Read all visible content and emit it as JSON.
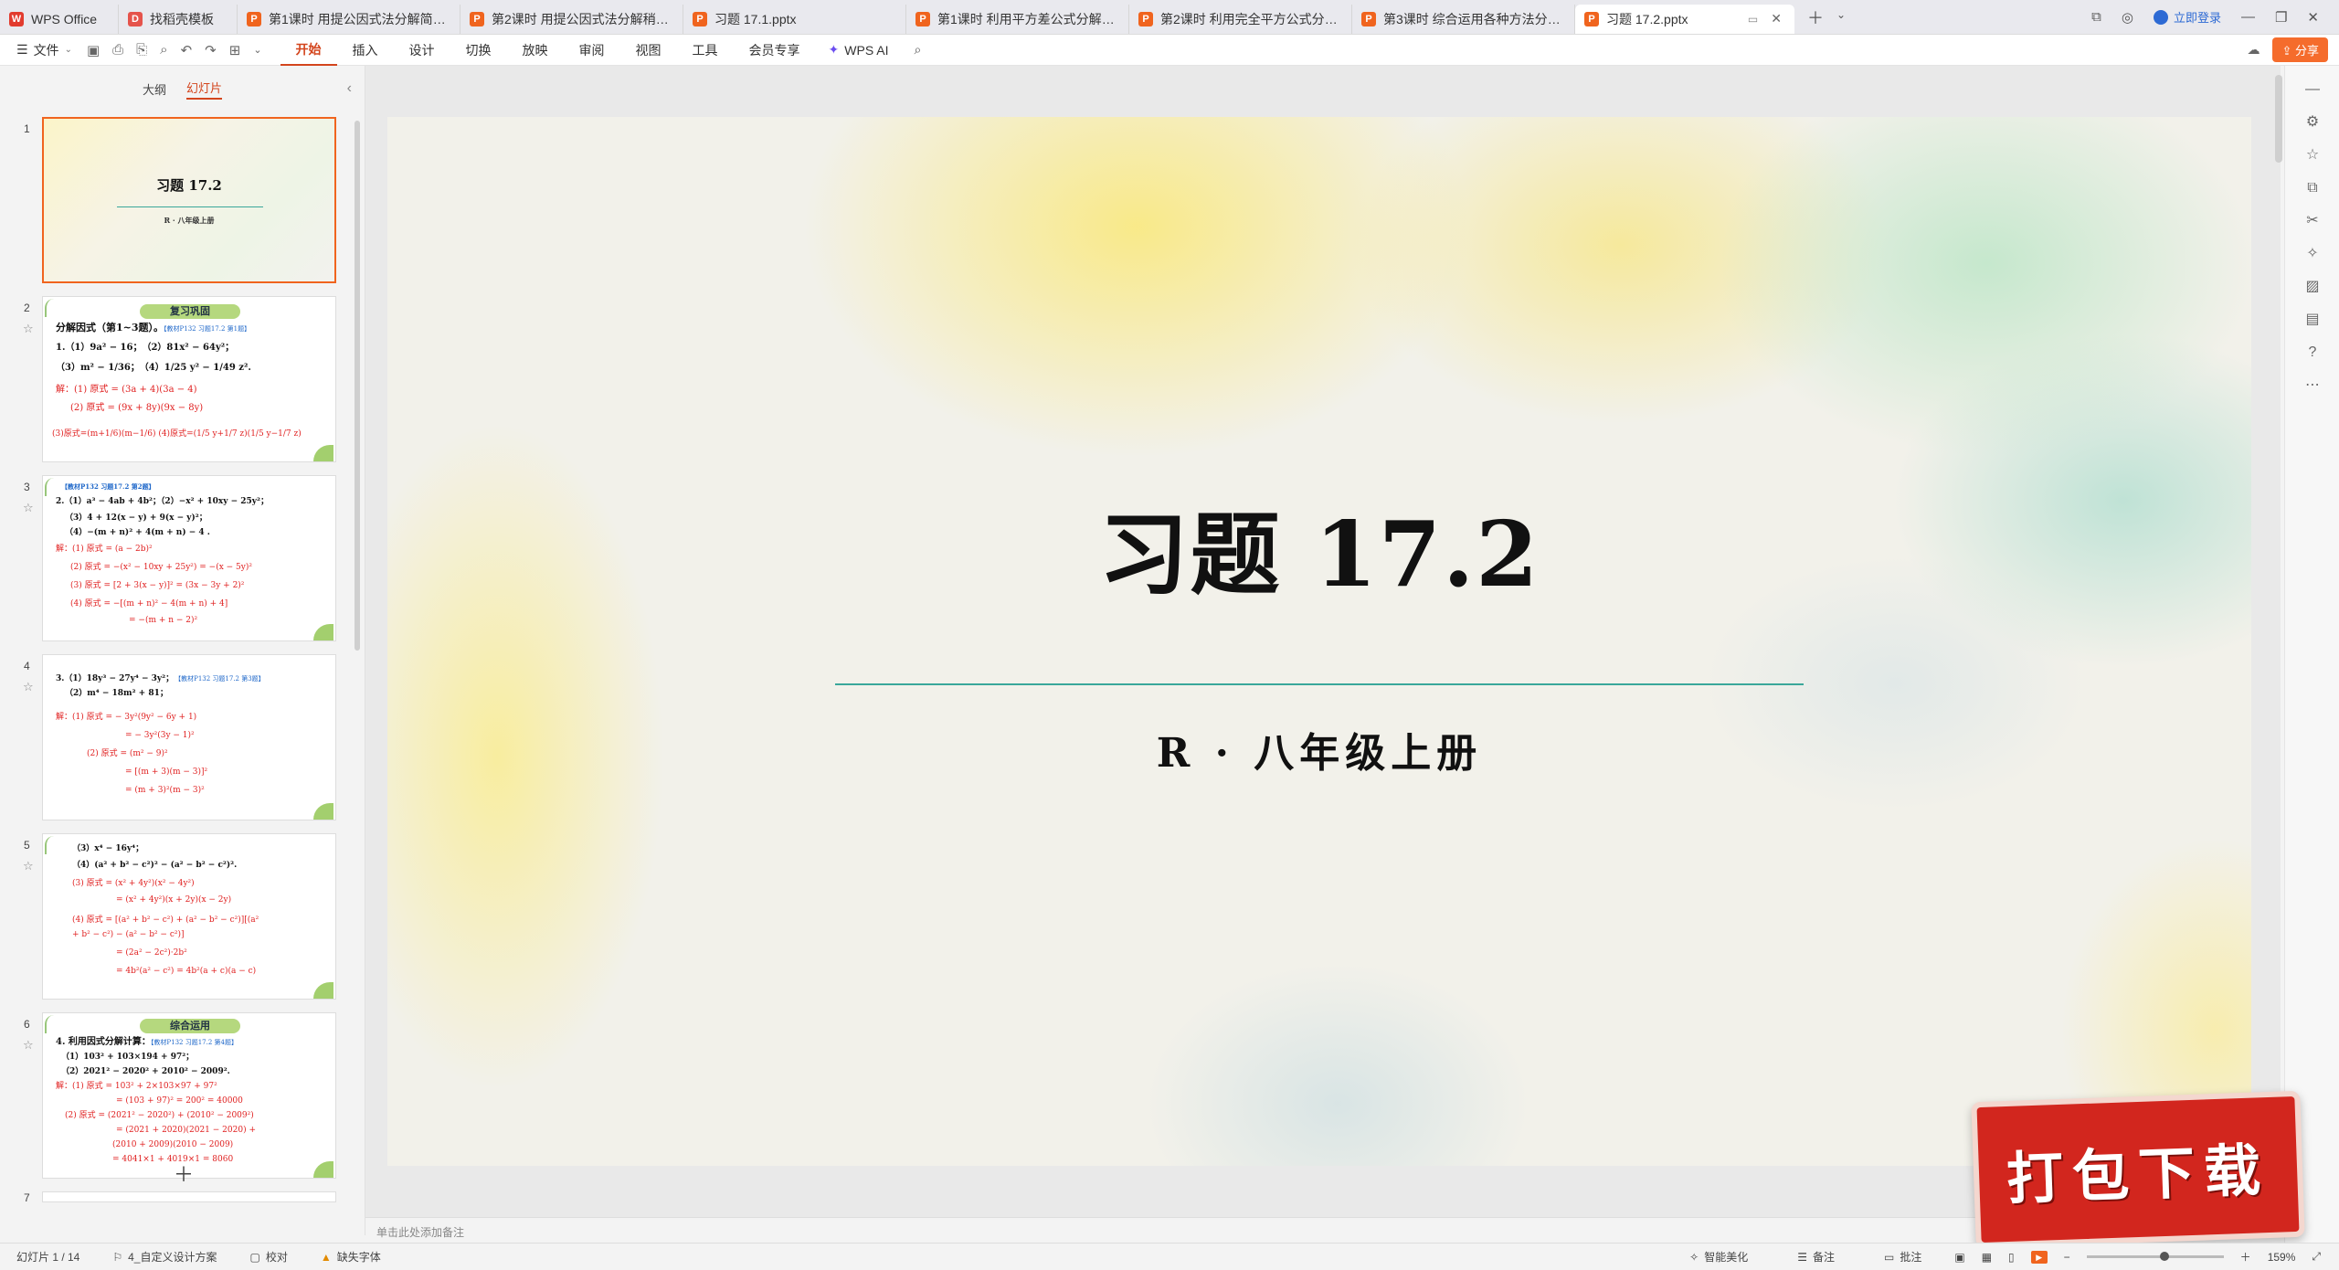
{
  "tabs": [
    {
      "label": "WPS Office",
      "icon": "wps"
    },
    {
      "label": "找稻壳模板",
      "icon": "doc"
    },
    {
      "label": "第1课时 用提公因式法分解简单的因式",
      "icon": "p"
    },
    {
      "label": "第2课时 用提公因式法分解稍复杂的因",
      "icon": "p"
    },
    {
      "label": "习题 17.1.pptx",
      "icon": "p"
    },
    {
      "label": "第1课时 利用平方差公式分解因式.pp",
      "icon": "p"
    },
    {
      "label": "第2课时 利用完全平方公式分解因式.p",
      "icon": "p"
    },
    {
      "label": "第3课时 综合运用各种方法分解因式.p",
      "icon": "p"
    },
    {
      "label": "习题 17.2.pptx",
      "icon": "p",
      "active": true
    }
  ],
  "titlebar": {
    "login": "立即登录"
  },
  "ribbon": {
    "file": "文件",
    "tabs": [
      "开始",
      "插入",
      "设计",
      "切换",
      "放映",
      "审阅",
      "视图",
      "工具",
      "会员专享"
    ],
    "active_tab": "开始",
    "ai": "WPS AI",
    "share": "分享"
  },
  "left_panel": {
    "outline": "大纲",
    "slides": "幻灯片"
  },
  "thumbnails": {
    "t1": {
      "num": "1",
      "title": "习题 17.2",
      "sub": "R · 八年级上册"
    },
    "t2": {
      "num": "2",
      "banner": "复习巩固",
      "l1": "分解因式（第1~3题）。",
      "l1b": "【教材P132 习题17.2 第1题】",
      "l2": "1.（1）9a² − 16；　（2）81x² − 64y²；",
      "l3": "（3）m² − 1/36；　（4）1/25 y² − 1/49 z².",
      "l4": "解：(1) 原式 = (3a + 4)(3a − 4)",
      "l5": "(2) 原式 = (9x + 8y)(9x − 8y)",
      "l6": "(3)原式=(m+1/6)(m−1/6)  (4)原式=(1/5 y+1/7 z)(1/5 y−1/7 z)"
    },
    "t3": {
      "num": "3",
      "l0": "【教材P132 习题17.2 第2题】",
      "l1": "2.（1）a³ − 4ab + 4b²；（2）−x² + 10xy − 25y²；",
      "l2": "（3）4 + 12(x − y) + 9(x − y)²；",
      "l3": "（4）−(m + n)² + 4(m + n) − 4 .",
      "l4": "解：(1) 原式 = (a − 2b)²",
      "l5": "(2) 原式 = −(x² − 10xy + 25y²) = −(x − 5y)²",
      "l6": "(3) 原式 = [2 + 3(x − y)]² = (3x − 3y + 2)²",
      "l7": "(4) 原式 = −[(m + n)² − 4(m + n) + 4]",
      "l8": "= −(m + n − 2)²"
    },
    "t4": {
      "num": "4",
      "l1": "3.（1）18y³ − 27y⁴ − 3y²；",
      "l1b": "【教材P132 习题17.2 第3题】",
      "l2": "（2）m⁴ − 18m² + 81；",
      "l3": "解：(1) 原式 = − 3y²(9y² − 6y + 1)",
      "l4": "= − 3y²(3y − 1)²",
      "l5": "(2) 原式 = (m² − 9)²",
      "l6": "= [(m + 3)(m − 3)]²",
      "l7": "= (m + 3)²(m − 3)²"
    },
    "t5": {
      "num": "5",
      "l1": "（3）x⁴ − 16y⁴；",
      "l2": "（4）(a² + b² − c²)² − (a² − b² − c²)².",
      "l3": "(3) 原式 = (x² + 4y²)(x² − 4y²)",
      "l4": "= (x² + 4y²)(x + 2y)(x − 2y)",
      "l5": "(4) 原式 = [(a² + b² − c²) + (a² − b² − c²)][(a²",
      "l6": "+ b² − c²) − (a² − b² − c²)]",
      "l7": "= (2a² − 2c²)·2b²",
      "l8": "= 4b²(a² − c²)  = 4b²(a + c)(a − c)"
    },
    "t6": {
      "num": "6",
      "banner": "综合运用",
      "l1": "4. 利用因式分解计算：",
      "l1b": "【教材P132 习题17.2 第4题】",
      "l2": "（1）103² + 103×194 + 97²；",
      "l3": "（2）2021² − 2020² + 2010² − 2009².",
      "l4": "解：(1) 原式 = 103² + 2×103×97 + 97²",
      "l5": "= (103 + 97)² = 200² = 40000",
      "l6": "(2) 原式 = (2021² − 2020²) + (2010² − 2009²)",
      "l7": "= (2021 + 2020)(2021 − 2020) +",
      "l8": "(2010 + 2009)(2010 − 2009)",
      "l9": "= 4041×1 + 4019×1 = 8060"
    },
    "t7": {
      "num": "7"
    }
  },
  "slide": {
    "title": "习题 17.2",
    "subtitle": "R · 八年级上册"
  },
  "notes_placeholder": "单击此处添加备注",
  "badge": "打包下载",
  "status": {
    "slide_count": "幻灯片 1 / 14",
    "theme": "4_自定义设计方案",
    "proofread": "校对",
    "missing_font": "缺失字体",
    "beautify": "智能美化",
    "notes": "备注",
    "comments": "批注",
    "zoom": "159%"
  },
  "colors": {
    "accent": "#d3451d",
    "ppt_orange": "#f0641e",
    "line_teal": "#3aa79a",
    "badge_red": "#d2261e"
  }
}
